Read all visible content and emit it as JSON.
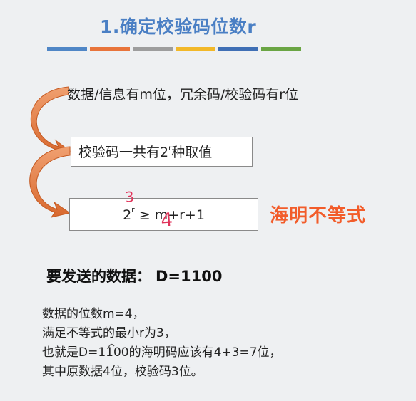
{
  "title": "1.确定校验码位数r",
  "color_bar": [
    "#4f86c6",
    "#e8743b",
    "#9d9d9d",
    "#f2b829",
    "#3f6fb5",
    "#6aa544"
  ],
  "statement": "数据/信息有m位，冗余码/校验码有r位",
  "box1": {
    "before": "校验码一共有2",
    "sup": "r",
    "after": "种取值"
  },
  "box2": {
    "base": "2",
    "sup": "r",
    "rest": " ≥ m+r+1"
  },
  "hamming_label": "海明不等式",
  "send_line": {
    "label": "要发送的数据：",
    "value": "D=1100"
  },
  "notes": [
    "数据的位数m=4，",
    "满足不等式的最小r为3，",
    "也就是D=1100的海明码应该有4+3=7位，",
    "其中原数据4位，校验码3位。"
  ],
  "handwritten": {
    "r_value": "3",
    "m_value": "4"
  }
}
